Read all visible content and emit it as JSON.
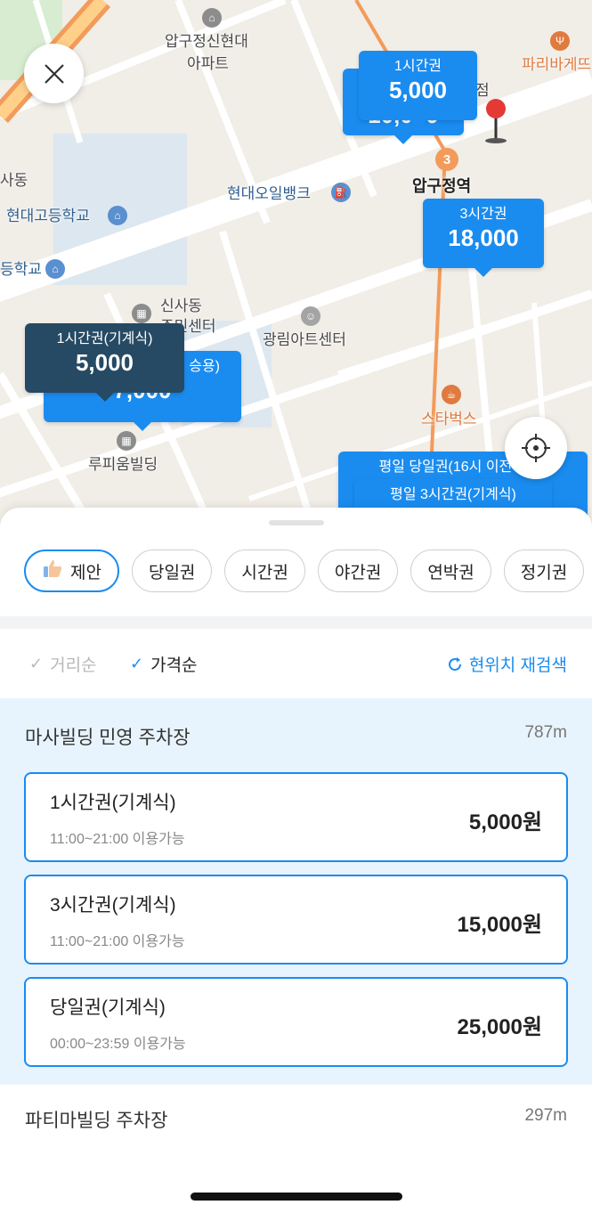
{
  "map": {
    "labels": {
      "apgujeong_hyundai_1": "압구정신현대",
      "apgujeong_hyundai_2": "아파트",
      "paris": "파리바게뜨",
      "station": "압구정역",
      "sadong": "사동",
      "hyundai_oil": "현대오일뱅크",
      "hyundai_high": "현대고등학교",
      "school_frag": "등학교",
      "sinsa_1": "신사동",
      "sinsa_2": "주민센터",
      "gwangrim": "광림아트센터",
      "starbucks": "스타벅스",
      "lupium": "루피움빌딩",
      "station_num": "3",
      "frag_jeom": "점"
    },
    "markers": {
      "m1": {
        "label": "1시간권",
        "value": "5,000"
      },
      "m1_back": {
        "value": "10,000"
      },
      "m2": {
        "label": "3시간권",
        "value": "18,000"
      },
      "m3": {
        "label": "1시간권(기계식)",
        "value": "5,000"
      },
      "m3_back": {
        "label": "승용)",
        "value": "7,000"
      },
      "m4": {
        "label": "평일 당일권(16시 이전 입차)"
      },
      "m5": {
        "label": "평일 3시간권(기계식)"
      }
    },
    "colors": {
      "marker_blue": "#1a8cf0",
      "marker_dark": "#264a63",
      "road_orange": "#f39b5a"
    }
  },
  "sheet": {
    "chips": [
      {
        "label": "제안",
        "icon": "thumbs-up-icon",
        "active": true
      },
      {
        "label": "당일권"
      },
      {
        "label": "시간권"
      },
      {
        "label": "야간권"
      },
      {
        "label": "연박권"
      },
      {
        "label": "정기권"
      }
    ],
    "sort": {
      "distance_label": "거리순",
      "price_label": "가격순",
      "research_label": "현위치 재검색"
    },
    "lots": [
      {
        "name": "마사빌딩 민영 주차장",
        "distance": "787m",
        "tickets": [
          {
            "name": "1시간권(기계식)",
            "hours": "11:00~21:00 이용가능",
            "price": "5,000원"
          },
          {
            "name": "3시간권(기계식)",
            "hours": "11:00~21:00 이용가능",
            "price": "15,000원"
          },
          {
            "name": "당일권(기계식)",
            "hours": "00:00~23:59 이용가능",
            "price": "25,000원"
          }
        ]
      },
      {
        "name": "파티마빌딩 주차장",
        "distance": "297m"
      }
    ]
  }
}
